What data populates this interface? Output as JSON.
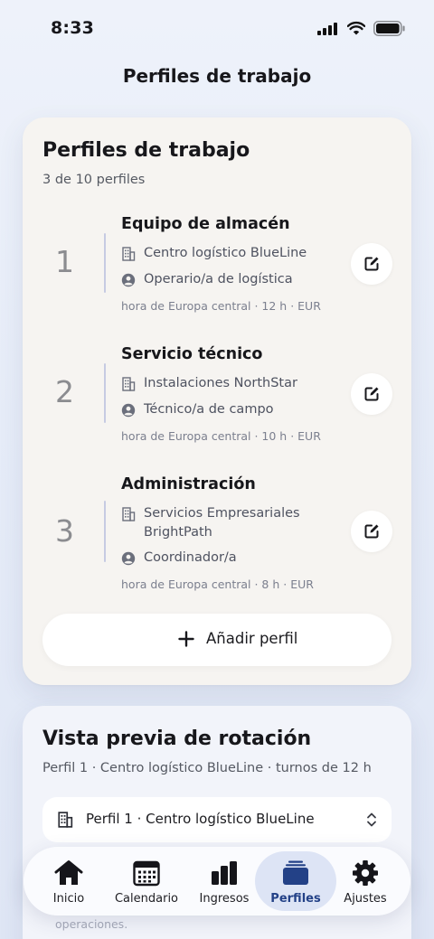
{
  "status_bar": {
    "time": "8:33"
  },
  "page": {
    "title": "Perfiles de trabajo"
  },
  "card": {
    "title": "Perfiles de trabajo",
    "subtitle": "3 de 10 perfiles",
    "profiles": [
      {
        "number": "1",
        "name": "Equipo de almacén",
        "company": "Centro logístico BlueLine",
        "role": "Operario/a de logística",
        "meta": "hora de Europa central · 12 h · EUR"
      },
      {
        "number": "2",
        "name": "Servicio técnico",
        "company": "Instalaciones NorthStar",
        "role": "Técnico/a de campo",
        "meta": "hora de Europa central · 10 h · EUR"
      },
      {
        "number": "3",
        "name": "Administración",
        "company": "Servicios Empresariales BrightPath",
        "role": "Coordinador/a",
        "meta": "hora de Europa central · 8 h · EUR"
      }
    ],
    "add_label": "Añadir perfil"
  },
  "preview": {
    "title": "Vista previa de rotación",
    "subtitle": "Perfil 1 · Centro logístico BlueLine · turnos de 12 h",
    "select_value": "Perfil 1 · Centro logístico BlueLine",
    "faded_text": "operaciones."
  },
  "tab_bar": {
    "tabs": [
      {
        "label": "Inicio",
        "icon": "home-icon"
      },
      {
        "label": "Calendario",
        "icon": "calendar-icon"
      },
      {
        "label": "Ingresos",
        "icon": "bar-chart-icon"
      },
      {
        "label": "Perfiles",
        "icon": "stack-icon",
        "active": true
      },
      {
        "label": "Ajustes",
        "icon": "gear-icon"
      }
    ]
  },
  "colors": {
    "accent": "#234187",
    "active_tab_bg": "#dde4f5",
    "card_bg": "#f6f4f1",
    "divider": "#c6cbe2"
  }
}
